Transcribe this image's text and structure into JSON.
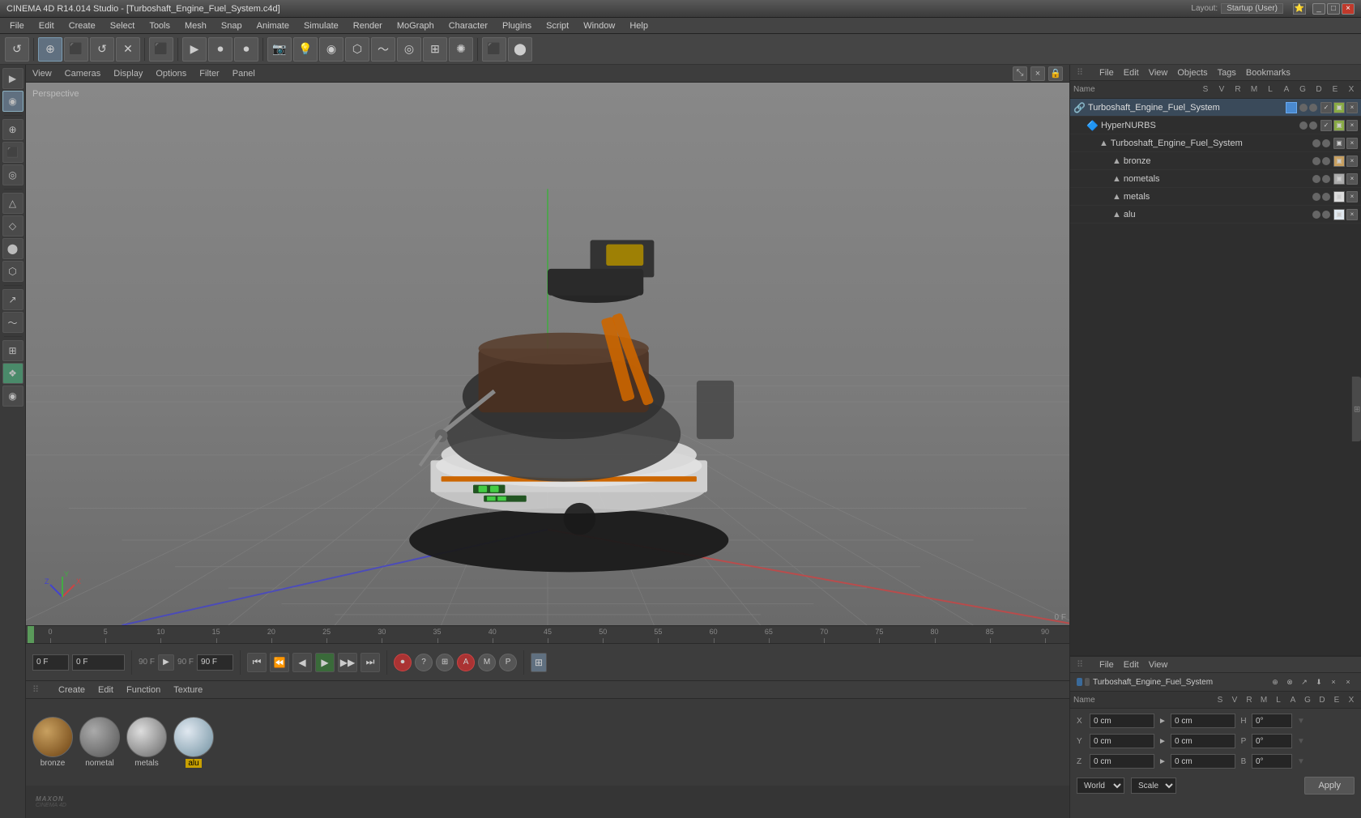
{
  "titlebar": {
    "title": "CINEMA 4D R14.014 Studio - [Turboshaft_Engine_Fuel_System.c4d]",
    "layout_label": "Layout:",
    "layout_value": "Startup (User)"
  },
  "menubar": {
    "items": [
      "File",
      "Edit",
      "Create",
      "Select",
      "Tools",
      "Mesh",
      "Snap",
      "Animate",
      "Simulate",
      "Render",
      "MoGraph",
      "Character",
      "Plugins",
      "Script",
      "Window",
      "Help"
    ]
  },
  "viewport": {
    "label": "Perspective",
    "menus": [
      "View",
      "Cameras",
      "Display",
      "Options",
      "Filter",
      "Panel"
    ],
    "frame_indicator": "0 F"
  },
  "left_toolbar": {
    "buttons": [
      "▶",
      "◉",
      "⊕",
      "⬛",
      "↺",
      "✱",
      "✚",
      "⬡",
      "△",
      "◇",
      "⬜",
      "⌇",
      "⌀",
      "❋",
      "⊞",
      "❖",
      "⊕"
    ]
  },
  "timeline": {
    "ticks": [
      0,
      5,
      10,
      15,
      20,
      25,
      30,
      35,
      40,
      45,
      50,
      55,
      60,
      65,
      70,
      75,
      80,
      85,
      90
    ]
  },
  "anim_controls": {
    "frame_start": "0 F",
    "current_frame": "0 F",
    "frame_end": "90 F",
    "frame_end2": "90 F",
    "buttons": [
      "⏮",
      "⏪",
      "◀",
      "▶",
      "▶▶",
      "⏭"
    ]
  },
  "material_editor": {
    "menus": [
      "Create",
      "Edit",
      "Function",
      "Texture"
    ],
    "materials": [
      {
        "name": "bronze",
        "type": "bronze",
        "active": false
      },
      {
        "name": "nometal",
        "type": "nometal",
        "active": false
      },
      {
        "name": "metals",
        "type": "metals",
        "active": false
      },
      {
        "name": "alu",
        "type": "alu",
        "active": true
      }
    ]
  },
  "object_manager": {
    "menus": [
      "File",
      "Edit",
      "View",
      "Objects",
      "Tags",
      "Bookmarks"
    ],
    "header_cols": [
      "S",
      "V",
      "R",
      "M",
      "L",
      "A",
      "G",
      "D",
      "E",
      "X"
    ],
    "objects": [
      {
        "indent": 0,
        "icon": "🔗",
        "name": "Turboshaft_Engine_Fuel_System",
        "color": "#4a8ad0",
        "has_color_swatch": true,
        "level": 0
      },
      {
        "indent": 1,
        "icon": "🔷",
        "name": "HyperNURBS",
        "color": "#888",
        "level": 1
      },
      {
        "indent": 2,
        "icon": "🔺",
        "name": "Turboshaft_Engine_Fuel_System",
        "color": "#aaa",
        "level": 2
      },
      {
        "indent": 3,
        "icon": "🔺",
        "name": "bronze",
        "color": "#c8a060",
        "level": 3
      },
      {
        "indent": 3,
        "icon": "🔺",
        "name": "nometals",
        "color": "#aaa",
        "level": 3
      },
      {
        "indent": 3,
        "icon": "🔺",
        "name": "metals",
        "color": "#aaa",
        "level": 3
      },
      {
        "indent": 3,
        "icon": "🔺",
        "name": "alu",
        "color": "#aaa",
        "level": 3
      }
    ],
    "selected_obj": "Turboshaft_Engine_Fuel_System"
  },
  "attributes": {
    "menus": [
      "Name",
      "S",
      "V",
      "R",
      "M",
      "L",
      "A",
      "G",
      "D",
      "E",
      "X"
    ],
    "selected_name": "Turboshaft_Engine_Fuel_System",
    "color": "#4a8ad0"
  },
  "coordinates": {
    "menus": [
      "File",
      "Edit",
      "View"
    ],
    "header_cols": [
      "S",
      "V",
      "R",
      "M",
      "L",
      "A",
      "G",
      "D",
      "E",
      "X"
    ],
    "rows": [
      {
        "axis": "X",
        "pos": "0 cm",
        "rot": "0°",
        "scale_label": "H",
        "scale_val": "0°"
      },
      {
        "axis": "Y",
        "pos": "0 cm",
        "rot": "0°",
        "scale_label": "P",
        "scale_val": "0°"
      },
      {
        "axis": "Z",
        "pos": "0 cm",
        "rot": "0°",
        "scale_label": "B",
        "scale_val": "0°"
      }
    ],
    "coord_system": "World",
    "scale_mode": "Scale",
    "apply_label": "Apply"
  }
}
